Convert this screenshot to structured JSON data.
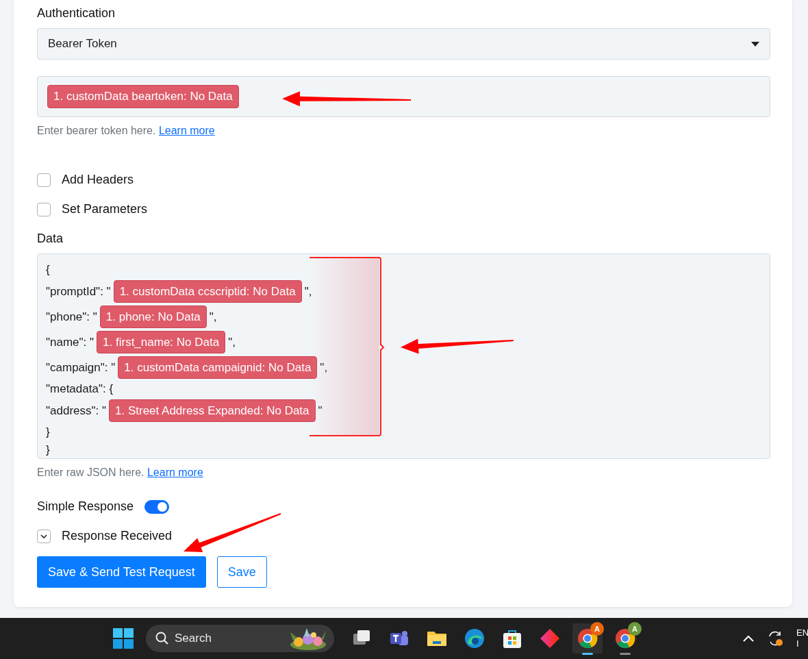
{
  "auth": {
    "label": "Authentication",
    "select_value": "Bearer Token",
    "token_tag": "1. customData beartoken: No Data",
    "help": "Enter bearer token here.",
    "help_link": "Learn more"
  },
  "options": [
    {
      "label": "Add Headers",
      "checked": false
    },
    {
      "label": "Set Parameters",
      "checked": false
    }
  ],
  "data": {
    "label": "Data",
    "lines": [
      {
        "text": "{"
      },
      {
        "text": "\"promptId\": \"",
        "tag": "1. customData ccscriptid: No Data",
        "suffix": "\","
      },
      {
        "text": "\"phone\": \"",
        "tag": "1. phone: No Data",
        "suffix": "\","
      },
      {
        "text": "\"name\": \"",
        "tag": "1. first_name: No Data",
        "suffix": "\","
      },
      {
        "text": "\"campaign\": \"",
        "tag": "1. customData campaignid: No Data",
        "suffix": "\","
      },
      {
        "text": "\"metadata\": {"
      },
      {
        "text": "\"address\": \"",
        "tag": "1. Street Address Expanded: No Data",
        "suffix": "\""
      },
      {
        "text": "}"
      },
      {
        "text": "}"
      }
    ],
    "help": "Enter raw JSON here.",
    "help_link": "Learn more"
  },
  "simple_response": {
    "label": "Simple Response",
    "on": true
  },
  "response_received": {
    "label": "Response Received",
    "expanded": false
  },
  "buttons": [
    {
      "label": "Save & Send Test Request",
      "kind": "primary"
    },
    {
      "label": "Save",
      "kind": "outline"
    }
  ],
  "taskbar": {
    "search_placeholder": "Search",
    "apps": [
      {
        "kind": "taskview"
      },
      {
        "kind": "teams"
      },
      {
        "kind": "folder"
      },
      {
        "kind": "edge"
      },
      {
        "kind": "store"
      },
      {
        "kind": "diamond"
      },
      {
        "kind": "chrome",
        "active": true,
        "badge": "A",
        "color": "#e8650f"
      },
      {
        "kind": "chrome",
        "active": false,
        "badge": "A",
        "color": "#6a9a3a"
      }
    ],
    "tray": [
      "EN",
      "I"
    ]
  }
}
